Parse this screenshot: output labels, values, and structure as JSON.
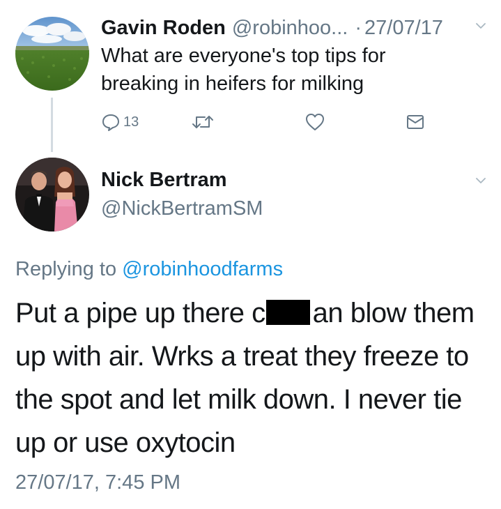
{
  "parent_tweet": {
    "author_name": "Gavin Roden",
    "author_handle": "@robinhoo...",
    "separator": "·",
    "date": "27/07/17",
    "text": "What are everyone's top tips for breaking in heifers for milking",
    "actions": {
      "reply_count": "13",
      "reply_icon": "reply-icon",
      "retweet_icon": "retweet-icon",
      "like_icon": "heart-icon",
      "dm_icon": "envelope-icon"
    }
  },
  "reply_tweet": {
    "author_name": "Nick Bertram",
    "author_handle": "@NickBertramSM",
    "replying_to_label": "Replying to",
    "replying_to_handle": "@robinhoodfarms",
    "text_before_redaction": "Put a pipe up there c",
    "text_after_redaction": "an blow them up with air.  Wrks a treat they freeze to the spot and let milk down. I never tie up or use oxytocin",
    "timestamp": "27/07/17, 7:45 PM"
  },
  "colors": {
    "text_primary": "#14171a",
    "text_secondary": "#657786",
    "link": "#1b95e0",
    "thread_line": "#d3dbe1",
    "caret": "#aab8c2"
  }
}
